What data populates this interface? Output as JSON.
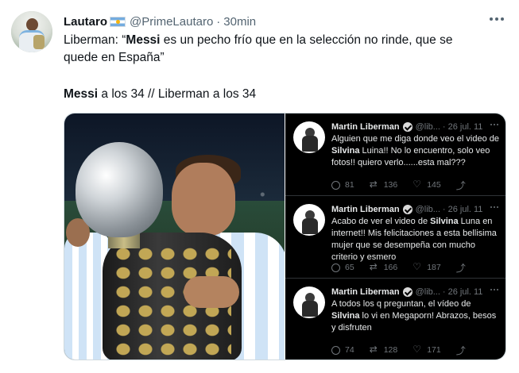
{
  "tweet": {
    "author_name": "Lautaro",
    "author_handle": "@PrimeLautaro",
    "separator": "·",
    "time": "30min",
    "line1_prefix": "Liberman: “",
    "line1_bold": "Messi",
    "line1_suffix": " es un pecho frío que en la selección no rinde, que se",
    "line2": "quede en España”",
    "line3_bold": "Messi",
    "line3_suffix": " a los 34 // Liberman a los 34"
  },
  "embedded_tweets": [
    {
      "name": "Martin Liberman",
      "handle": "@lib...",
      "separator": "·",
      "date": "26 jul. 11",
      "text_pre": "Alguien que me diga donde veo el video de ",
      "text_bold": "Silvina",
      "text_post": " Luina!! No lo encuentro, solo veo fotos!! quiero verlo......esta mal???",
      "replies": "81",
      "retweets": "136",
      "likes": "145"
    },
    {
      "name": "Martin Liberman",
      "handle": "@lib...",
      "separator": "·",
      "date": "26 jul. 11",
      "text_pre": "Acabo de ver el video de ",
      "text_bold": "Silvina",
      "text_post": " Luna en internet!! Mis felicitaciones a esta bellisima mujer que se desempeña con mucho criterio y esmero",
      "replies": "65",
      "retweets": "166",
      "likes": "187"
    },
    {
      "name": "Martin Liberman",
      "handle": "@lib...",
      "separator": "·",
      "date": "26 jul. 11",
      "text_pre": "A todos los q preguntan, el vídeo de ",
      "text_bold": "Silvina",
      "text_post": " lo vi en Megaporn! Abrazos, besos y disfruten",
      "replies": "74",
      "retweets": "128",
      "likes": "171"
    }
  ],
  "colors": {
    "text_primary": "#0f1419",
    "text_secondary": "#536471",
    "dark_bg": "#000000",
    "dark_text": "#e7e9ea",
    "dark_muted": "#71767b"
  },
  "icons": [
    "more-icon",
    "argentina-flag-icon",
    "verified-icon",
    "reply-icon",
    "retweet-icon",
    "like-icon",
    "share-icon"
  ]
}
